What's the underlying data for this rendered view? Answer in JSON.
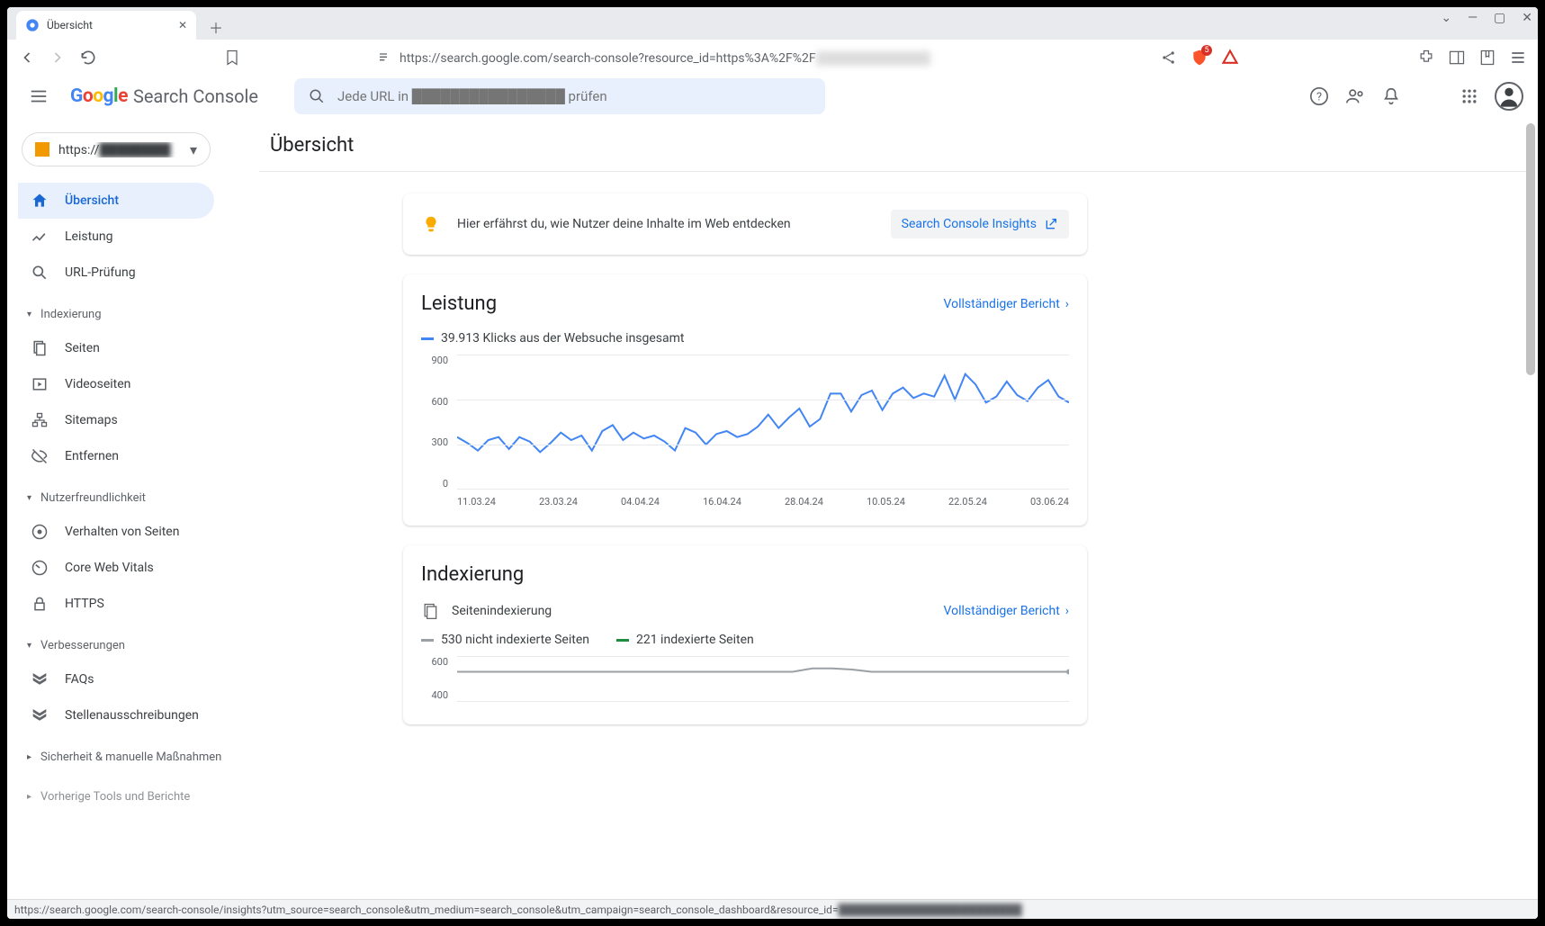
{
  "browser": {
    "tab_title": "Übersicht",
    "url_prefix": "https://search.google.com/search-console?resource_id=https%3A%2F%2F",
    "url_blurred": "████████████",
    "badge_count": "5"
  },
  "header": {
    "logo_text": "Search Console",
    "search_placeholder": "Jede URL in ████████████████ prüfen"
  },
  "property": {
    "label_prefix": "https://",
    "label_blurred": "████████"
  },
  "sidebar": {
    "items_top": [
      {
        "label": "Übersicht",
        "icon": "home",
        "active": true
      },
      {
        "label": "Leistung",
        "icon": "trend"
      },
      {
        "label": "URL-Prüfung",
        "icon": "search"
      }
    ],
    "section_indexing": "Indexierung",
    "items_indexing": [
      {
        "label": "Seiten",
        "icon": "pages"
      },
      {
        "label": "Videoseiten",
        "icon": "video"
      },
      {
        "label": "Sitemaps",
        "icon": "sitemap"
      },
      {
        "label": "Entfernen",
        "icon": "remove"
      }
    ],
    "section_ux": "Nutzerfreundlichkeit",
    "items_ux": [
      {
        "label": "Verhalten von Seiten",
        "icon": "behavior"
      },
      {
        "label": "Core Web Vitals",
        "icon": "speed"
      },
      {
        "label": "HTTPS",
        "icon": "lock"
      }
    ],
    "section_enh": "Verbesserungen",
    "items_enh": [
      {
        "label": "FAQs",
        "icon": "faq"
      },
      {
        "label": "Stellenausschreibungen",
        "icon": "jobs"
      }
    ],
    "section_security": "Sicherheit & manuelle Maßnahmen",
    "section_legacy": "Vorherige Tools und Berichte"
  },
  "page": {
    "title": "Übersicht"
  },
  "insight": {
    "text": "Hier erfährst du, wie Nutzer deine Inhalte im Web entdecken",
    "button": "Search Console Insights"
  },
  "performance": {
    "title": "Leistung",
    "full_report": "Vollständiger Bericht",
    "legend": "39.913 Klicks aus der Websuche insgesamt"
  },
  "indexing": {
    "title": "Indexierung",
    "subtitle": "Seitenindexierung",
    "full_report": "Vollständiger Bericht",
    "legend_not_indexed": "530 nicht indexierte Seiten",
    "legend_indexed": "221 indexierte Seiten"
  },
  "status_bar": {
    "url": "https://search.google.com/search-console/insights?utm_source=search_console&utm_medium=search_console&utm_campaign=search_console_dashboard&resource_id=",
    "blurred": "████████████████████████"
  },
  "chart_data": [
    {
      "type": "line",
      "title": "Leistung",
      "ylabel": "Klicks",
      "ylim": [
        0,
        900
      ],
      "x_ticks": [
        "11.03.24",
        "23.03.24",
        "04.04.24",
        "16.04.24",
        "28.04.24",
        "10.05.24",
        "22.05.24",
        "03.06.24"
      ],
      "series": [
        {
          "name": "Klicks aus der Websuche",
          "color": "#4285F4",
          "values": [
            350,
            310,
            260,
            330,
            350,
            270,
            350,
            320,
            250,
            310,
            380,
            330,
            360,
            260,
            390,
            430,
            330,
            380,
            340,
            360,
            320,
            260,
            410,
            380,
            300,
            370,
            390,
            350,
            370,
            420,
            500,
            410,
            480,
            540,
            420,
            470,
            640,
            640,
            520,
            630,
            660,
            530,
            640,
            680,
            610,
            640,
            620,
            760,
            600,
            770,
            700,
            580,
            620,
            720,
            630,
            590,
            680,
            730,
            620,
            580
          ]
        }
      ]
    },
    {
      "type": "line",
      "title": "Indexierung",
      "ylabel": "Seiten",
      "ylim": [
        0,
        600
      ],
      "y_ticks": [
        600,
        400
      ],
      "series": [
        {
          "name": "nicht indexierte Seiten",
          "color": "#9aa0a6",
          "values": [
            530,
            530,
            530,
            530,
            530,
            530,
            530,
            530,
            530,
            530,
            530,
            530,
            530,
            530,
            530,
            530,
            530,
            530,
            545,
            545,
            540,
            530,
            530,
            530,
            530,
            530,
            530,
            530,
            530,
            530,
            530,
            530
          ]
        },
        {
          "name": "indexierte Seiten",
          "color": "#1e8e3e",
          "values": [
            221,
            221,
            221,
            221,
            221,
            221,
            221,
            221,
            221,
            221,
            221,
            221,
            221,
            221,
            221,
            221,
            221,
            221,
            221,
            221,
            221,
            221,
            221,
            221,
            221,
            221,
            221,
            221,
            221,
            221,
            221,
            221
          ]
        }
      ]
    }
  ]
}
